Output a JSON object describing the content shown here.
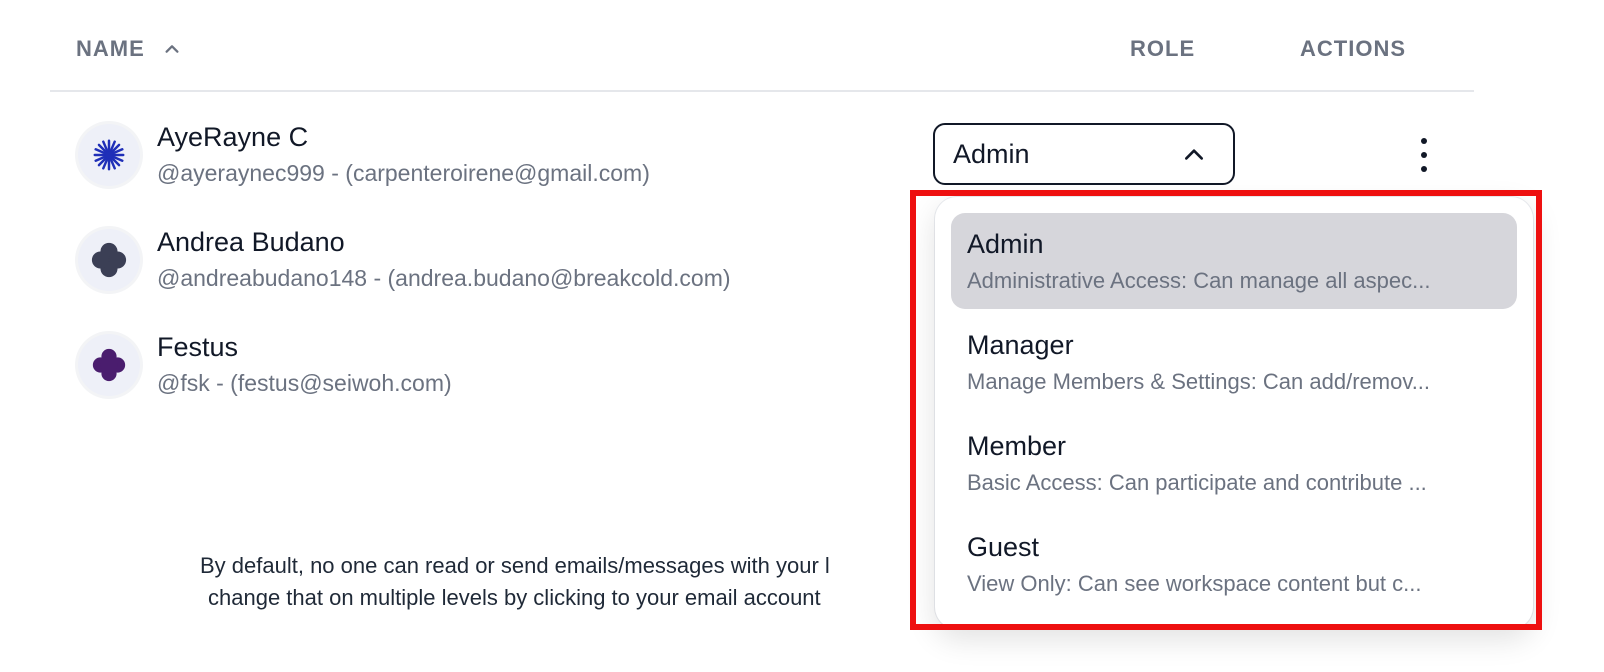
{
  "table": {
    "headers": {
      "name": "NAME",
      "role": "ROLE",
      "actions": "ACTIONS"
    }
  },
  "users": [
    {
      "name": "AyeRayne C",
      "sub": "@ayeraynec999 - (carpenteroirene@gmail.com)"
    },
    {
      "name": "Andrea Budano",
      "sub": "@andreabudano148 - (andrea.budano@breakcold.com)"
    },
    {
      "name": "Festus",
      "sub": "@fsk - (festus@seiwoh.com)"
    }
  ],
  "role_select": {
    "value": "Admin"
  },
  "role_options": [
    {
      "title": "Admin",
      "desc": "Administrative Access: Can manage all aspec..."
    },
    {
      "title": "Manager",
      "desc": "Manage Members & Settings: Can add/remov..."
    },
    {
      "title": "Member",
      "desc": "Basic Access: Can participate and contribute ..."
    },
    {
      "title": "Guest",
      "desc": "View Only: Can see workspace content but c..."
    }
  ],
  "note": {
    "line1": "By default, no one can read or send emails/messages with your l",
    "line2": "change that on multiple levels by clicking to your email account"
  },
  "colors": {
    "highlight": "#ee1010",
    "selected_option": "#d6d6db",
    "avatar_1": "#1f2fb8",
    "avatar_2": "#3b3f55",
    "avatar_3": "#4a1d6e"
  }
}
